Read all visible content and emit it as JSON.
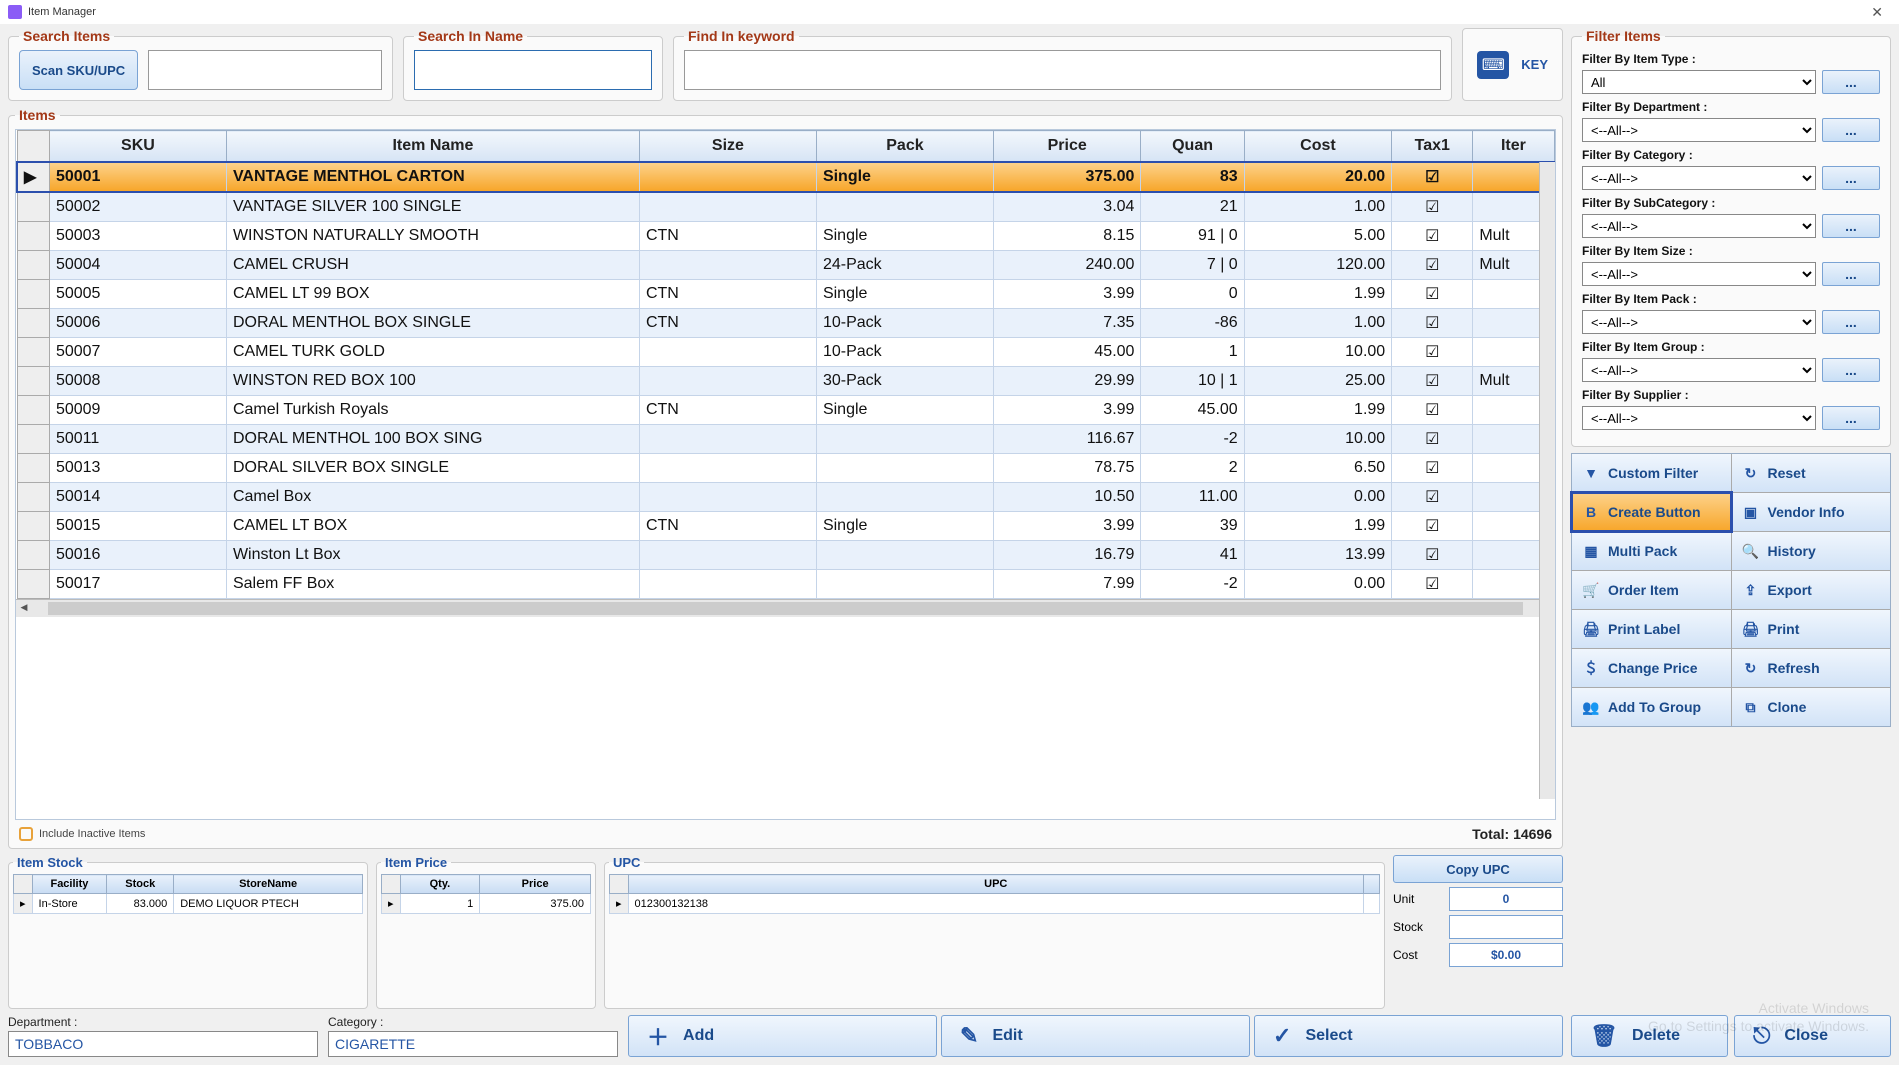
{
  "titlebar": {
    "title": "Item Manager"
  },
  "search": {
    "items_legend": "Search Items",
    "scan_btn": "Scan SKU/UPC",
    "name_legend": "Search In Name",
    "keyword_legend": "Find In keyword",
    "key_label": "KEY"
  },
  "items": {
    "legend": "Items",
    "headers": {
      "sku": "SKU",
      "name": "Item Name",
      "size": "Size",
      "pack": "Pack",
      "price": "Price",
      "quan": "Quan",
      "cost": "Cost",
      "tax": "Tax1",
      "item": "Iter"
    },
    "rows": [
      {
        "sku": "50001",
        "name": "VANTAGE MENTHOL CARTON",
        "size": "",
        "pack": "Single",
        "price": "375.00",
        "quan": "83",
        "cost": "20.00",
        "tax": true,
        "item": "",
        "selected": true
      },
      {
        "sku": "50002",
        "name": "VANTAGE SILVER 100 SINGLE",
        "size": "",
        "pack": "",
        "price": "3.04",
        "quan": "21",
        "cost": "1.00",
        "tax": true,
        "item": ""
      },
      {
        "sku": "50003",
        "name": "WINSTON NATURALLY SMOOTH",
        "size": "CTN",
        "pack": "Single",
        "price": "8.15",
        "quan": "91 | 0",
        "cost": "5.00",
        "tax": true,
        "item": "Mult"
      },
      {
        "sku": "50004",
        "name": "CAMEL CRUSH",
        "size": "",
        "pack": "24-Pack",
        "price": "240.00",
        "quan": "7 | 0",
        "cost": "120.00",
        "tax": true,
        "item": "Mult"
      },
      {
        "sku": "50005",
        "name": "CAMEL LT 99 BOX",
        "size": "CTN",
        "pack": "Single",
        "price": "3.99",
        "quan": "0",
        "cost": "1.99",
        "tax": true,
        "item": ""
      },
      {
        "sku": "50006",
        "name": "DORAL MENTHOL BOX SINGLE",
        "size": "CTN",
        "pack": "10-Pack",
        "price": "7.35",
        "quan": "-86",
        "cost": "1.00",
        "tax": true,
        "item": ""
      },
      {
        "sku": "50007",
        "name": "CAMEL TURK GOLD",
        "size": "",
        "pack": "10-Pack",
        "price": "45.00",
        "quan": "1",
        "cost": "10.00",
        "tax": true,
        "item": ""
      },
      {
        "sku": "50008",
        "name": "WINSTON RED BOX 100",
        "size": "",
        "pack": "30-Pack",
        "price": "29.99",
        "quan": "10 | 1",
        "cost": "25.00",
        "tax": true,
        "item": "Mult"
      },
      {
        "sku": "50009",
        "name": "Camel Turkish Royals",
        "size": "CTN",
        "pack": "Single",
        "price": "3.99",
        "quan": "45.00",
        "cost": "1.99",
        "tax": true,
        "item": ""
      },
      {
        "sku": "50011",
        "name": "DORAL MENTHOL 100 BOX SING",
        "size": "",
        "pack": "",
        "price": "116.67",
        "quan": "-2",
        "cost": "10.00",
        "tax": true,
        "item": ""
      },
      {
        "sku": "50013",
        "name": "DORAL SILVER BOX SINGLE",
        "size": "",
        "pack": "",
        "price": "78.75",
        "quan": "2",
        "cost": "6.50",
        "tax": true,
        "item": ""
      },
      {
        "sku": "50014",
        "name": "Camel Box",
        "size": "",
        "pack": "",
        "price": "10.50",
        "quan": "11.00",
        "cost": "0.00",
        "tax": true,
        "item": ""
      },
      {
        "sku": "50015",
        "name": "CAMEL LT BOX",
        "size": "CTN",
        "pack": "Single",
        "price": "3.99",
        "quan": "39",
        "cost": "1.99",
        "tax": true,
        "item": ""
      },
      {
        "sku": "50016",
        "name": "Winston Lt Box",
        "size": "",
        "pack": "",
        "price": "16.79",
        "quan": "41",
        "cost": "13.99",
        "tax": true,
        "item": ""
      },
      {
        "sku": "50017",
        "name": "Salem FF Box",
        "size": "",
        "pack": "",
        "price": "7.99",
        "quan": "-2",
        "cost": "0.00",
        "tax": true,
        "item": ""
      }
    ],
    "include_inactive": "Include Inactive Items",
    "total_label": "Total: 14696"
  },
  "stock": {
    "legend": "Item Stock",
    "headers": {
      "facility": "Facility",
      "stock": "Stock",
      "store": "StoreName"
    },
    "rows": [
      {
        "facility": "In-Store",
        "stock": "83.000",
        "store": "DEMO LIQUOR PTECH"
      }
    ]
  },
  "price": {
    "legend": "Item Price",
    "headers": {
      "qty": "Qty.",
      "price": "Price"
    },
    "rows": [
      {
        "qty": "1",
        "price": "375.00"
      }
    ]
  },
  "upc": {
    "legend": "UPC",
    "header": "UPC",
    "rows": [
      {
        "upc": "012300132138"
      }
    ]
  },
  "copy": {
    "btn": "Copy UPC",
    "unit_label": "Unit",
    "unit_val": "0",
    "stock_label": "Stock",
    "stock_val": "",
    "cost_label": "Cost",
    "cost_val": "$0.00"
  },
  "dept": {
    "label": "Department :",
    "value": "TOBBACO"
  },
  "cat": {
    "label": "Category :",
    "value": "CIGARETTE"
  },
  "actions": {
    "add": "Add",
    "edit": "Edit",
    "select": "Select",
    "delete": "Delete",
    "close": "Close"
  },
  "filter": {
    "legend": "Filter Items",
    "type": {
      "label": "Filter By Item Type :",
      "value": "All"
    },
    "dept": {
      "label": "Filter By Department :",
      "value": "<--All-->"
    },
    "cat": {
      "label": "Filter By Category :",
      "value": "<--All-->"
    },
    "sub": {
      "label": "Filter By SubCategory :",
      "value": "<--All-->"
    },
    "size": {
      "label": "Filter By Item Size :",
      "value": "<--All-->"
    },
    "pack": {
      "label": "Filter By Item Pack :",
      "value": "<--All-->"
    },
    "group": {
      "label": "Filter By Item Group :",
      "value": "<--All-->"
    },
    "supplier": {
      "label": "Filter By Supplier :",
      "value": "<--All-->"
    },
    "dots": "..."
  },
  "sidebtns": {
    "custom": "Custom Filter",
    "reset": "Reset",
    "create": "Create Button",
    "vendor": "Vendor Info",
    "multi": "Multi Pack",
    "history": "History",
    "order": "Order Item",
    "export": "Export",
    "label": "Print Label",
    "print": "Print",
    "change": "Change Price",
    "refresh": "Refresh",
    "group": "Add To Group",
    "clone": "Clone"
  },
  "watermark": {
    "l1": "Activate Windows",
    "l2": "Go to Settings to activate Windows."
  }
}
